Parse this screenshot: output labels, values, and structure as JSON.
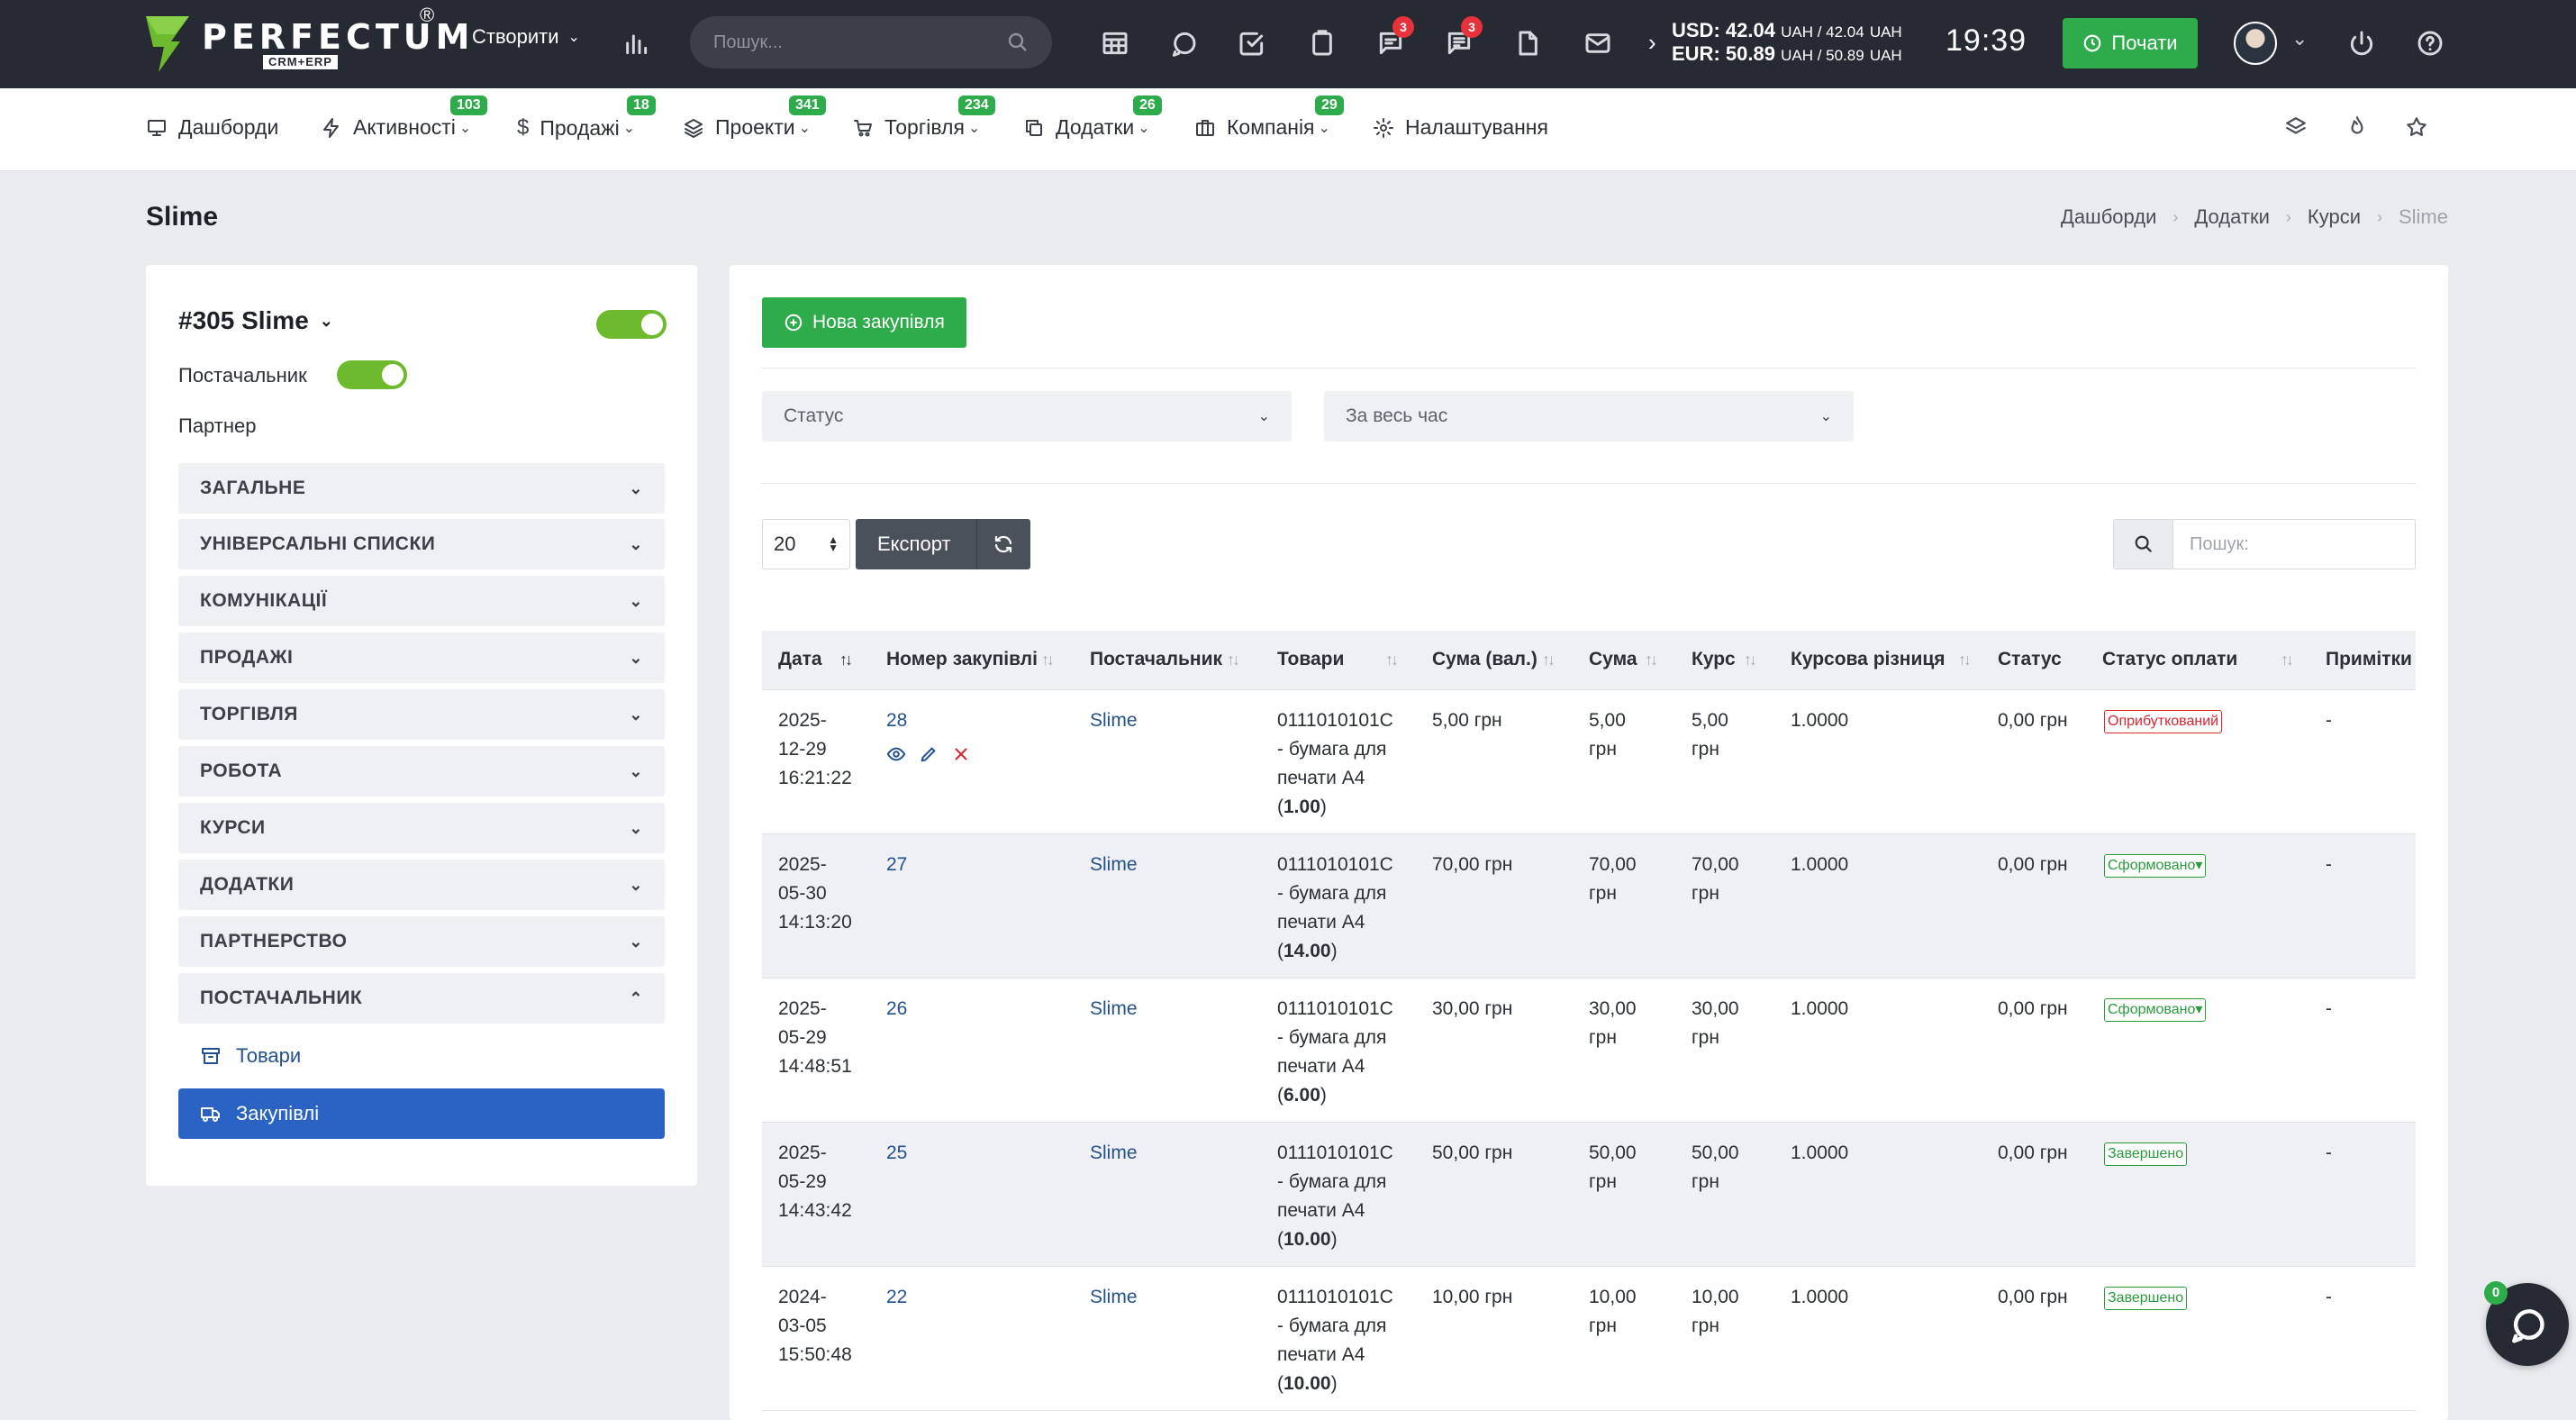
{
  "app": {
    "logo_word": "PERFECTUM",
    "logo_sub": "CRM+ERP",
    "logo_reg": "®",
    "create_label": "Створити",
    "search_placeholder": "Пошук...",
    "badges": {
      "messages": "3",
      "chat": "3"
    },
    "rates_usd": "USD: 42.04",
    "rates_usd_unit": "UAH / 42.04",
    "rates_usd_unit2": "UAH",
    "rates_eur": "EUR: 50.89",
    "rates_eur_unit": "UAH / 50.89",
    "rates_eur_unit2": "UAH",
    "clock": "19:39",
    "start_label": "Почати"
  },
  "menu": [
    {
      "label": "Дашборди",
      "icon": "monitor-icon",
      "badge": ""
    },
    {
      "label": "Активності",
      "icon": "bolt-icon",
      "badge": "103"
    },
    {
      "label": "Продажі",
      "icon": "dollar-icon",
      "badge": "18"
    },
    {
      "label": "Проекти",
      "icon": "layers-icon",
      "badge": "341"
    },
    {
      "label": "Торгівля",
      "icon": "cart-icon",
      "badge": "234"
    },
    {
      "label": "Додатки",
      "icon": "copy-icon",
      "badge": "26"
    },
    {
      "label": "Компанія",
      "icon": "briefcase-icon",
      "badge": "29"
    },
    {
      "label": "Налаштування",
      "icon": "gear-icon",
      "badge": ""
    }
  ],
  "page": {
    "title": "Slime",
    "breadcrumb": [
      "Дашборди",
      "Додатки",
      "Курси",
      "Slime"
    ]
  },
  "left": {
    "title": "#305 Slime",
    "supplier_label": "Постачальник",
    "partner_label": "Партнер",
    "sections": [
      "ЗАГАЛЬНЕ",
      "УНІВЕРСАЛЬНІ СПИСКИ",
      "КОМУНІКАЦІЇ",
      "ПРОДАЖІ",
      "ТОРГІВЛЯ",
      "РОБОТА",
      "КУРСИ",
      "ДОДАТКИ",
      "ПАРТНЕРСТВО",
      "ПОСТАЧАЛЬНИК"
    ],
    "sub_items": [
      "Товари",
      "Закупівлі"
    ]
  },
  "main": {
    "new_button": "Нова закупівля",
    "filter_status": "Статус",
    "filter_period": "За весь час",
    "per_page": "20",
    "export_label": "Експорт",
    "search_placeholder": "Пошук:",
    "columns": [
      "Дата",
      "Номер закупівлі",
      "Постачальник",
      "Товари",
      "Сума (вал.)",
      "Сума",
      "Курс",
      "Курсова різниця",
      "Статус",
      "Статус оплати",
      "Примітки"
    ],
    "rows": [
      {
        "date1": "2025-",
        "date2": "12-29",
        "date3": "16:21:22",
        "number": "28",
        "supplier": "Slime",
        "goods1": "0111010101C",
        "goods2": "- бумага для",
        "goods3": "печати А4",
        "qty": "1.00",
        "sum_cur": "5,00 грн",
        "sum1": "5,00",
        "sum2": "грн",
        "rate1": "5,00",
        "rate2": "грн",
        "diff": "1.0000",
        "status": "0,00 грн",
        "pay_status": "Оприбуткований",
        "pay_color": "red",
        "note": "-"
      },
      {
        "date1": "2025-",
        "date2": "05-30",
        "date3": "14:13:20",
        "number": "27",
        "supplier": "Slime",
        "goods1": "0111010101C",
        "goods2": "- бумага для",
        "goods3": "печати А4",
        "qty": "14.00",
        "sum_cur": "70,00 грн",
        "sum1": "70,00",
        "sum2": "грн",
        "rate1": "70,00",
        "rate2": "грн",
        "diff": "1.0000",
        "status": "0,00 грн",
        "pay_status": "Сформовано▾",
        "pay_color": "green",
        "note": "-"
      },
      {
        "date1": "2025-",
        "date2": "05-29",
        "date3": "14:48:51",
        "number": "26",
        "supplier": "Slime",
        "goods1": "0111010101C",
        "goods2": "- бумага для",
        "goods3": "печати А4",
        "qty": "6.00",
        "sum_cur": "30,00 грн",
        "sum1": "30,00",
        "sum2": "грн",
        "rate1": "30,00",
        "rate2": "грн",
        "diff": "1.0000",
        "status": "0,00 грн",
        "pay_status": "Сформовано▾",
        "pay_color": "green",
        "note": "-"
      },
      {
        "date1": "2025-",
        "date2": "05-29",
        "date3": "14:43:42",
        "number": "25",
        "supplier": "Slime",
        "goods1": "0111010101C",
        "goods2": "- бумага для",
        "goods3": "печати А4",
        "qty": "10.00",
        "sum_cur": "50,00 грн",
        "sum1": "50,00",
        "sum2": "грн",
        "rate1": "50,00",
        "rate2": "грн",
        "diff": "1.0000",
        "status": "0,00 грн",
        "pay_status": "Завершено",
        "pay_color": "green",
        "note": "-"
      },
      {
        "date1": "2024-",
        "date2": "03-05",
        "date3": "15:50:48",
        "number": "22",
        "supplier": "Slime",
        "goods1": "0111010101C",
        "goods2": "- бумага для",
        "goods3": "печати А4",
        "qty": "10.00",
        "sum_cur": "10,00 грн",
        "sum1": "10,00",
        "sum2": "грн",
        "rate1": "10,00",
        "rate2": "грн",
        "diff": "1.0000",
        "status": "0,00 грн",
        "pay_status": "Завершено",
        "pay_color": "green",
        "note": "-"
      }
    ]
  },
  "chat": {
    "badge": "0"
  },
  "colors": {
    "topbar": "#262a33",
    "accent_green": "#2eab4b",
    "active_blue": "#2b63c4",
    "link": "#23518f",
    "toggle_green": "#6dba2e"
  }
}
